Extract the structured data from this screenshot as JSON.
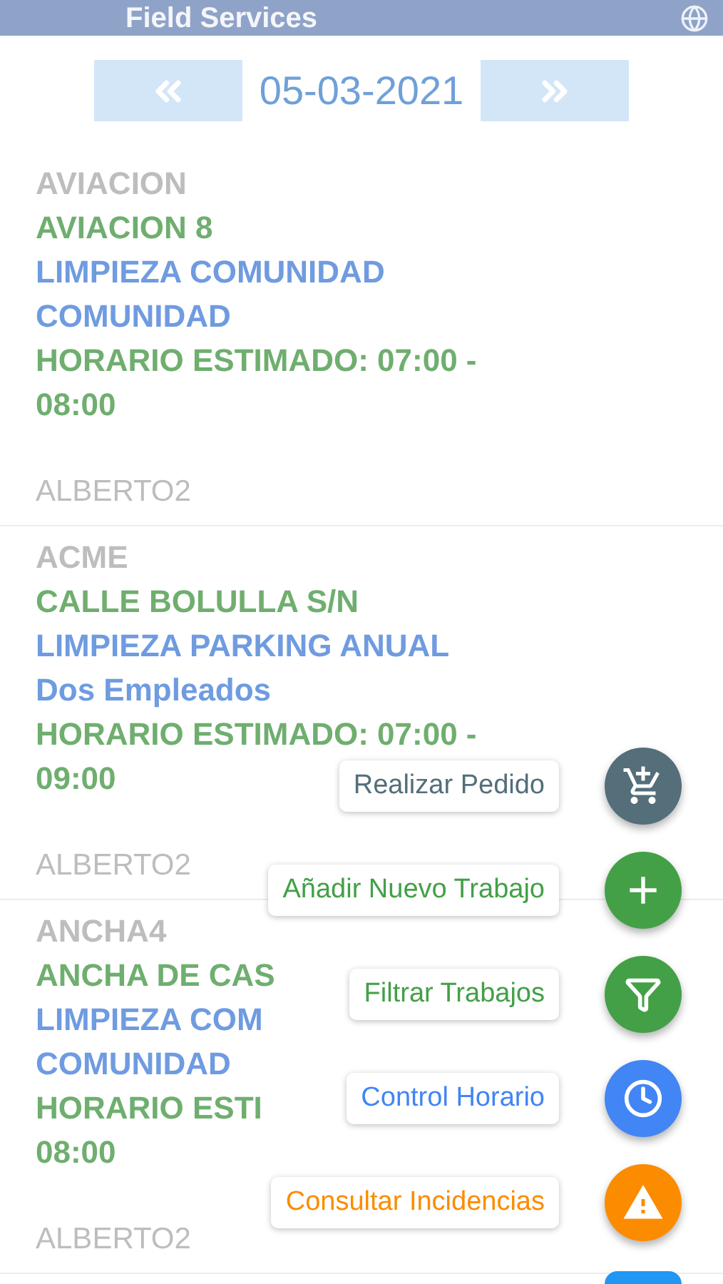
{
  "header": {
    "title": "Field Services"
  },
  "date_bar": {
    "date": "05-03-2021"
  },
  "jobs": [
    {
      "client": "AVIACION",
      "lines": [
        {
          "kind": "address",
          "text": "AVIACION 8"
        },
        {
          "kind": "service",
          "text": "LIMPIEZA COMUNIDAD"
        },
        {
          "kind": "service",
          "text": "COMUNIDAD"
        },
        {
          "kind": "schedule",
          "text": "HORARIO ESTIMADO: 07:00 -"
        },
        {
          "kind": "schedule",
          "text": "08:00"
        }
      ],
      "worker": "ALBERTO2"
    },
    {
      "client": "ACME",
      "lines": [
        {
          "kind": "address",
          "text": "CALLE BOLULLA S/N"
        },
        {
          "kind": "service",
          "text": "LIMPIEZA PARKING ANUAL"
        },
        {
          "kind": "service",
          "text": "Dos Empleados"
        },
        {
          "kind": "schedule",
          "text": "HORARIO ESTIMADO: 07:00 -"
        },
        {
          "kind": "schedule",
          "text": "09:00"
        }
      ],
      "worker": "ALBERTO2"
    },
    {
      "client": "ANCHA4",
      "lines": [
        {
          "kind": "address",
          "text": "ANCHA DE CAS"
        },
        {
          "kind": "service",
          "text": "LIMPIEZA COM"
        },
        {
          "kind": "service",
          "text": "COMUNIDAD"
        },
        {
          "kind": "schedule",
          "text": "HORARIO ESTI"
        },
        {
          "kind": "schedule",
          "text": "08:00"
        }
      ],
      "worker": "ALBERTO2"
    }
  ],
  "fab_menu": [
    {
      "label": "Realizar Pedido",
      "kind": "order",
      "color": "#546e7a"
    },
    {
      "label": "Añadir Nuevo Trabajo",
      "kind": "add",
      "color": "#43a047"
    },
    {
      "label": "Filtrar Trabajos",
      "kind": "filter",
      "color": "#43a047"
    },
    {
      "label": "Control Horario",
      "kind": "clock",
      "color": "#4285f4"
    },
    {
      "label": "Consultar Incidencias",
      "kind": "warning",
      "color": "#fb8c00"
    }
  ]
}
